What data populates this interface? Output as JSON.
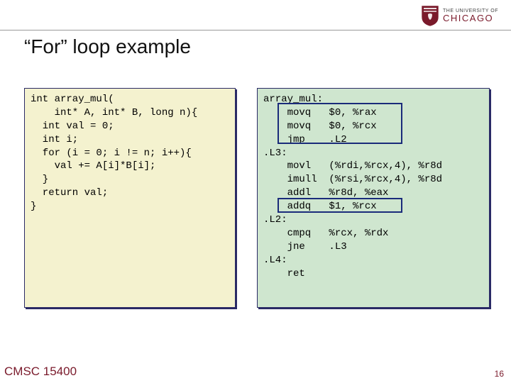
{
  "logo": {
    "top": "THE UNIVERSITY OF",
    "bottom": "CHICAGO"
  },
  "title": "“For” loop example",
  "code_left": "int array_mul(\n    int* A, int* B, long n){\n  int val = 0;\n  int i;\n  for (i = 0; i != n; i++){\n    val += A[i]*B[i];\n  }\n  return val;\n}",
  "code_right": "array_mul:\n    movq   $0, %rax\n    movq   $0, %rcx\n    jmp    .L2\n.L3:\n    movl   (%rdi,%rcx,4), %r8d\n    imull  (%rsi,%rcx,4), %r8d\n    addl   %r8d, %eax\n    addq   $1, %rcx\n.L2:\n    cmpq   %rcx, %rdx\n    jne    .L3\n.L4:\n    ret",
  "footer": {
    "course": "CMSC 15400",
    "page": "16"
  }
}
